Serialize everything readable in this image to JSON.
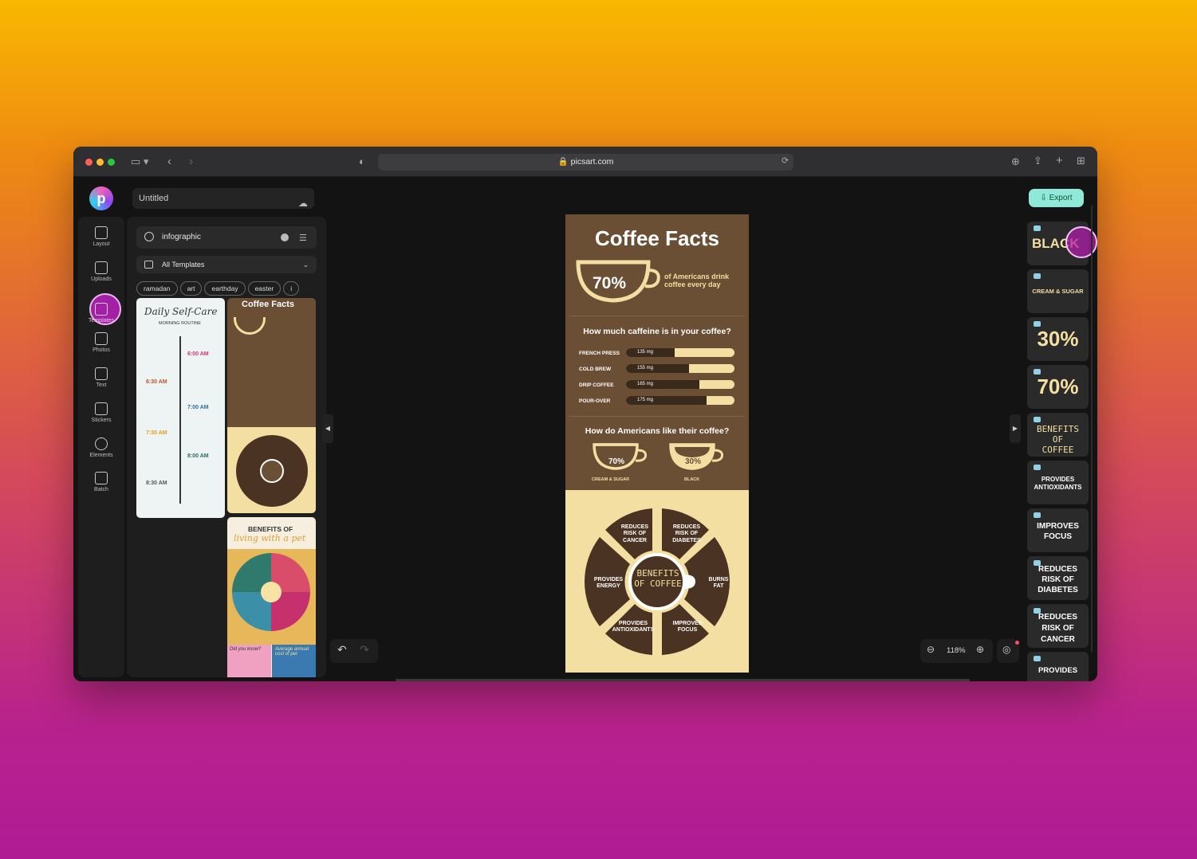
{
  "browser": {
    "url": "picsart.com"
  },
  "app": {
    "doc_title": "Untitled",
    "rail": [
      {
        "label": "Layout",
        "icon": "layout-icon"
      },
      {
        "label": "Uploads",
        "icon": "upload-icon"
      },
      {
        "label": "Templates",
        "icon": "templates-icon"
      },
      {
        "label": "Photos",
        "icon": "photos-icon"
      },
      {
        "label": "Text",
        "icon": "text-icon"
      },
      {
        "label": "Stickers",
        "icon": "stickers-icon"
      },
      {
        "label": "Elements",
        "icon": "elements-icon"
      },
      {
        "label": "Batch",
        "icon": "batch-icon"
      }
    ],
    "search": {
      "value": "infographic"
    },
    "dropdown": "All Templates",
    "chips": [
      "ramadan",
      "art",
      "earthday",
      "easter",
      "i"
    ],
    "thumbs": {
      "selfcare_title": "Daily Self-Care",
      "selfcare_sub": "MORNING ROUTINE",
      "times": [
        "6:00 AM",
        "6:30 AM",
        "7:00 AM",
        "7:30 AM",
        "8:00 AM",
        "8:30 AM"
      ],
      "coffee_title": "Coffee Facts",
      "pet_title": "BENEFITS OF",
      "pet_sub": "living with a pet",
      "pet_did": "Did you know?",
      "pet_avg": "Average annual cost of pet"
    },
    "zoom": "118%",
    "export_label": "Export"
  },
  "poster": {
    "title": "Coffee Facts",
    "pct": "70%",
    "pct_caption": "of Americans drink coffee every day",
    "q1": "How much caffeine is in your coffee?",
    "bars": [
      {
        "label": "FRENCH PRESS",
        "value": "135 mg",
        "fill": 0.45
      },
      {
        "label": "COLD BREW",
        "value": "155 mg",
        "fill": 0.58
      },
      {
        "label": "DRIP COFFEE",
        "value": "165 mg",
        "fill": 0.68
      },
      {
        "label": "POUR-OVER",
        "value": "175 mg",
        "fill": 0.74
      }
    ],
    "q2": "How do Americans like their coffee?",
    "cup1_pct": "70%",
    "cup1_label": "CREAM & SUGAR",
    "cup2_pct": "30%",
    "cup2_label": "BLACK",
    "wheel": {
      "center": "BENEFITS OF COFFEE",
      "segments": [
        "REDUCES RISK OF CANCER",
        "REDUCES RISK OF DIABETES",
        "BURNS FAT",
        "IMPROVES FOCUS",
        "PROVIDES ANTIOXIDANTS",
        "PROVIDES ENERGY"
      ]
    }
  },
  "layers": [
    "BLACK",
    "CREAM & SUGAR",
    "30%",
    "70%",
    "BENEFITS OF COFFEE",
    "PROVIDES ANTIOXIDANTS",
    "IMPROVES FOCUS",
    "REDUCES RISK OF DIABETES",
    "REDUCES RISK OF CANCER",
    "PROVIDES"
  ]
}
